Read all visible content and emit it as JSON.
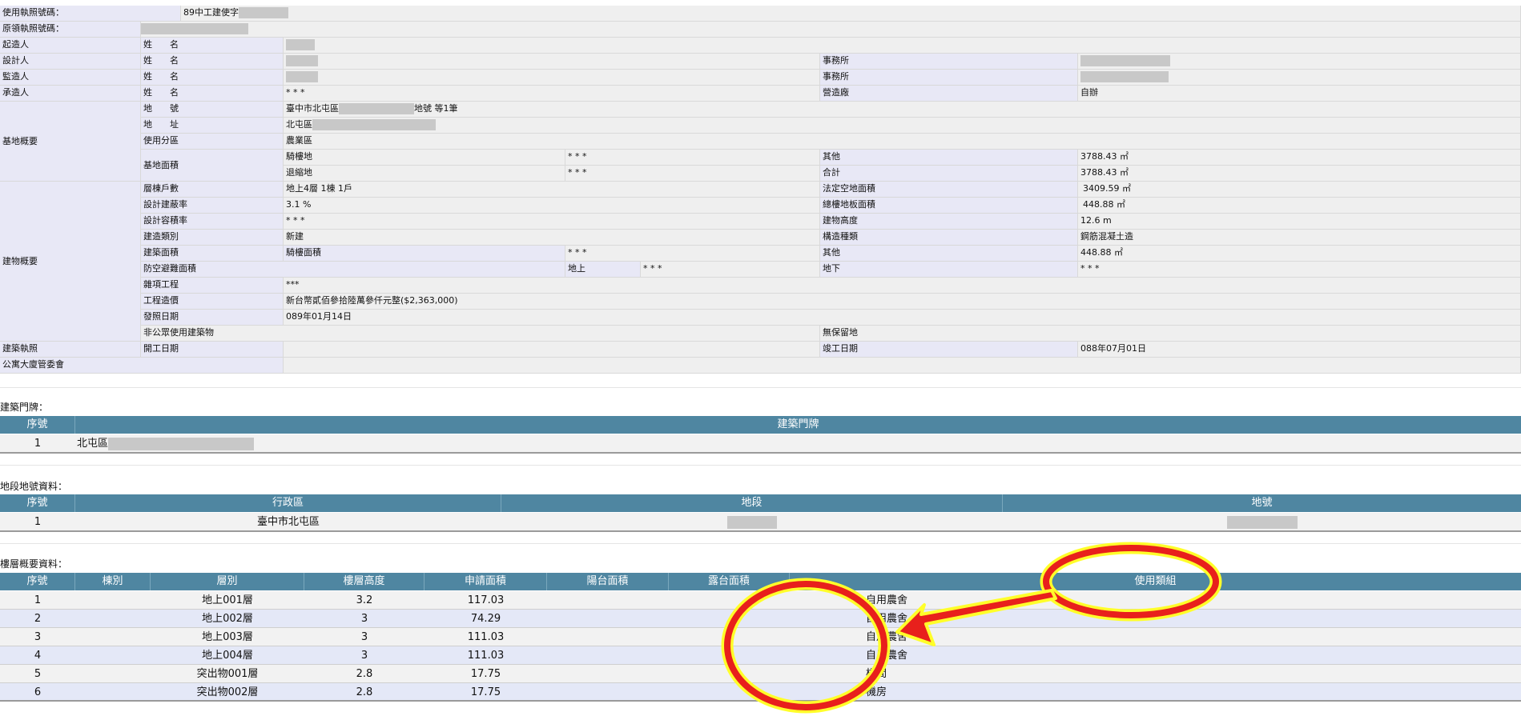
{
  "info": {
    "license_no_label": "使用執照號碼：",
    "license_no_value": "89中工建使字",
    "orig_license_label": "原領執照號碼：",
    "applicant": "起造人",
    "designer": "設計人",
    "supervisor": "監造人",
    "contractor": "承造人",
    "name_label": "姓　　名",
    "office_label": "事務所",
    "builder_label": "營造廠",
    "contractor_name": "* * *",
    "builder_value": "自辦",
    "site_overview": "基地概要",
    "lot_no_label": "地　　號",
    "lot_no_prefix": "臺中市北屯區",
    "lot_no_suffix": "地號 等1筆",
    "address_label": "地　　址",
    "address_prefix": "北屯區",
    "zoning_label": "使用分區",
    "zoning_value": "農業區",
    "site_area_label": "基地面積",
    "arcade_land": "騎樓地",
    "arcade_land_value": "* * *",
    "setback_land": "退縮地",
    "setback_land_value": "* * *",
    "other_label": "其他",
    "other_value": "3788.43 ㎡",
    "total_label": "合計",
    "total_value": "3788.43 ㎡",
    "building_overview": "建物概要",
    "floors_label": "層棟戶數",
    "floors_value": "地上4層 1棟 1戶",
    "open_space_label": "法定空地面積",
    "open_space_value": "3409.59 ㎡",
    "coverage_label": "設計建蔽率",
    "coverage_value": "3.1 %",
    "total_floor_label": "總樓地板面積",
    "total_floor_value": "448.88 ㎡",
    "far_label": "設計容積率",
    "far_value": "* * *",
    "height_label": "建物高度",
    "height_value": "12.6 m",
    "build_type_label": "建造類別",
    "build_type_value": "新建",
    "struct_label": "構造種類",
    "struct_value": "鋼筋混凝土造",
    "build_area_label": "建築面積",
    "arcade_area_label": "騎樓面積",
    "arcade_area_value": "* * *",
    "other2_label": "其他",
    "other2_value": "448.88 ㎡",
    "shelter_label": "防空避難面積",
    "above_label": "地上",
    "above_value": "* * *",
    "below_label": "地下",
    "below_value": "* * *",
    "misc_label": "雜項工程",
    "misc_value": "***",
    "cost_label": "工程造價",
    "cost_value": "新台幣貳佰參拾陸萬參仟元整($2,363,000)",
    "issue_label": "發照日期",
    "issue_value": "089年01月14日",
    "non_public_label": "非公眾使用建築物",
    "no_reserve_label": "無保留地",
    "permit_label": "建築執照",
    "start_label": "開工日期",
    "finish_label": "竣工日期",
    "finish_value": "088年07月01日",
    "committee_label": "公寓大廈管委會"
  },
  "doorplate": {
    "title": "建築門牌：",
    "headers": [
      "序號",
      "建築門牌"
    ],
    "rows": [
      {
        "no": "1",
        "prefix": "北屯區"
      }
    ]
  },
  "lots": {
    "title": "地段地號資料：",
    "headers": [
      "序號",
      "行政區",
      "地段",
      "地號"
    ],
    "rows": [
      {
        "no": "1",
        "district": "臺中市北屯區"
      }
    ]
  },
  "floors": {
    "title": "樓層概要資料：",
    "headers": [
      "序號",
      "棟別",
      "層別",
      "樓層高度",
      "申請面積",
      "陽台面積",
      "露台面積",
      "",
      "使用類組"
    ],
    "rows": [
      {
        "no": "1",
        "bldg": "",
        "floor": "地上001層",
        "height": "3.2",
        "area": "117.03",
        "balcony": "",
        "terrace": "",
        "use": "自用農舍"
      },
      {
        "no": "2",
        "bldg": "",
        "floor": "地上002層",
        "height": "3",
        "area": "74.29",
        "balcony": "",
        "terrace": "",
        "use": "自用農舍"
      },
      {
        "no": "3",
        "bldg": "",
        "floor": "地上003層",
        "height": "3",
        "area": "111.03",
        "balcony": "",
        "terrace": "",
        "use": "自用農舍"
      },
      {
        "no": "4",
        "bldg": "",
        "floor": "地上004層",
        "height": "3",
        "area": "111.03",
        "balcony": "",
        "terrace": "",
        "use": "自用農舍"
      },
      {
        "no": "5",
        "bldg": "",
        "floor": "突出物001層",
        "height": "2.8",
        "area": "17.75",
        "balcony": "",
        "terrace": "",
        "use": "梯間"
      },
      {
        "no": "6",
        "bldg": "",
        "floor": "突出物002層",
        "height": "2.8",
        "area": "17.75",
        "balcony": "",
        "terrace": "",
        "use": "機房"
      }
    ]
  },
  "annotation": {
    "ellipse_color": "#e8201c",
    "outline_color": "#ffff2a"
  }
}
